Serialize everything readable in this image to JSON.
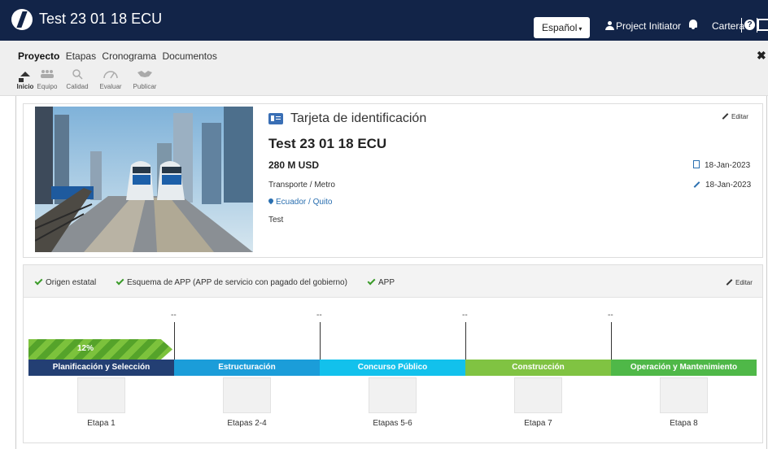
{
  "header": {
    "app_title": "Test 23 01 18 ECU",
    "language": "Español",
    "user": "Project Initiator",
    "portfolio": "Cartera",
    "help_glyph": "?"
  },
  "nav": {
    "tabs": [
      "Proyecto",
      "Etapas",
      "Cronograma",
      "Documentos"
    ],
    "close_glyph": "✖",
    "subnav": [
      "Inicio",
      "Equipo",
      "Calidad",
      "Evaluar",
      "Publicar"
    ]
  },
  "id_card": {
    "title": "Tarjeta de identificación",
    "edit_label": "Editar",
    "project_name": "Test 23 01 18 ECU",
    "amount": "280 M USD",
    "sector": "Transporte / Metro",
    "location": "Ecuador / Quito",
    "description": "Test",
    "created_date": "18-Jan-2023",
    "modified_date": "18-Jan-2023"
  },
  "attributes": {
    "items": [
      "Origen estatal",
      "Esquema de APP (APP de servicio con pagado del gobierno)",
      "APP"
    ],
    "edit_label": "Editar"
  },
  "timeline": {
    "progress_pct": 12,
    "progress_label": "12%",
    "markers": [
      "--",
      "--",
      "--",
      "--"
    ],
    "stages": [
      {
        "name": "Planificación y Selección",
        "label": "Etapa 1",
        "color": "#233f73"
      },
      {
        "name": "Estructuración",
        "label": "Etapas 2-4",
        "color": "#1b9dd9"
      },
      {
        "name": "Concurso Público",
        "label": "Etapas 5-6",
        "color": "#12c1ec"
      },
      {
        "name": "Construcción",
        "label": "Etapa 7",
        "color": "#80c342"
      },
      {
        "name": "Operación y Mantenimiento",
        "label": "Etapa 8",
        "color": "#4fb848"
      }
    ]
  },
  "colors": {
    "header_bg": "#122448",
    "accent_blue": "#2a6fb0",
    "check_green": "#3a9b29"
  }
}
